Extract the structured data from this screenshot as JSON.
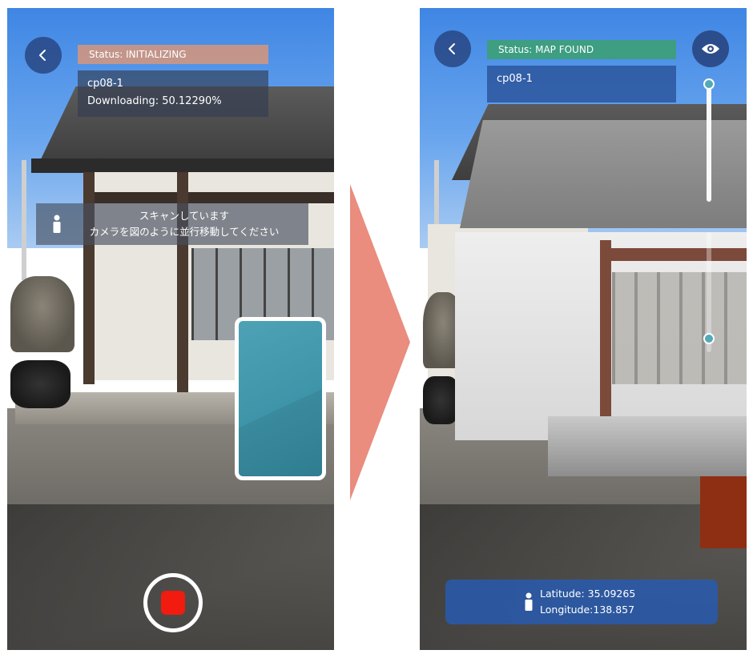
{
  "left_screen": {
    "status": "Status: INITIALIZING",
    "map_name": "cp08-1",
    "download": "Downloading: 50.12290%",
    "scan_line1": "スキャンしています",
    "scan_line2": "カメラを図のように並行移動してください"
  },
  "right_screen": {
    "status": "Status: MAP FOUND",
    "map_name": "cp08-1",
    "latitude": "Latitude: 35.09265",
    "longitude": "Longitude:138.857"
  },
  "colors": {
    "status_initializing": "#cd9682",
    "status_found": "#3ca078",
    "record": "#f11b10",
    "arrow": "#ea8c7e"
  }
}
